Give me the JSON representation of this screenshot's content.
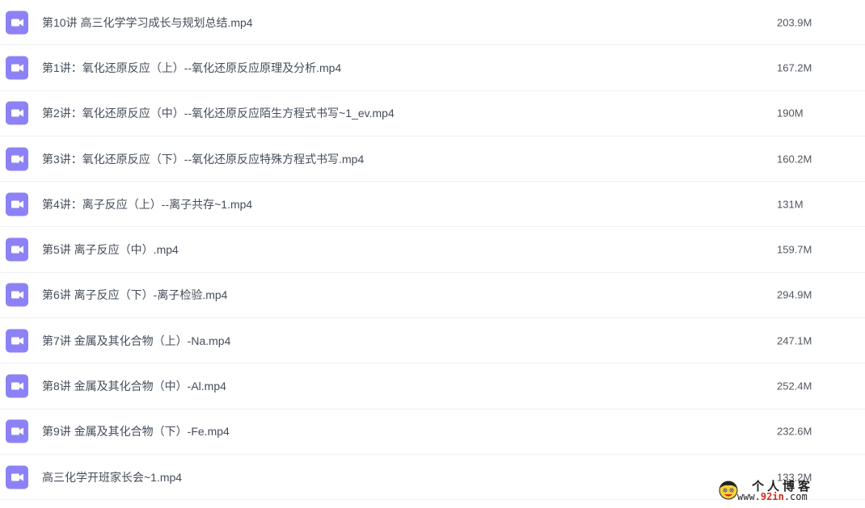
{
  "files": [
    {
      "name": "第10讲 高三化学学习成长与规划总结.mp4",
      "size": "203.9M",
      "icon": "video-icon"
    },
    {
      "name": "第1讲：氧化还原反应（上）--氧化还原反应原理及分析.mp4",
      "size": "167.2M",
      "icon": "video-icon"
    },
    {
      "name": "第2讲：氧化还原反应（中）--氧化还原反应陌生方程式书写~1_ev.mp4",
      "size": "190M",
      "icon": "video-icon"
    },
    {
      "name": "第3讲：氧化还原反应（下）--氧化还原反应特殊方程式书写.mp4",
      "size": "160.2M",
      "icon": "video-icon"
    },
    {
      "name": "第4讲：离子反应（上）--离子共存~1.mp4",
      "size": "131M",
      "icon": "video-icon"
    },
    {
      "name": "第5讲 离子反应（中）.mp4",
      "size": "159.7M",
      "icon": "video-icon"
    },
    {
      "name": "第6讲 离子反应（下）-离子检验.mp4",
      "size": "294.9M",
      "icon": "video-icon"
    },
    {
      "name": "第7讲 金属及其化合物（上）-Na.mp4",
      "size": "247.1M",
      "icon": "video-icon"
    },
    {
      "name": "第8讲 金属及其化合物（中）-Al.mp4",
      "size": "252.4M",
      "icon": "video-icon"
    },
    {
      "name": "第9讲 金属及其化合物（下）-Fe.mp4",
      "size": "232.6M",
      "icon": "video-icon"
    },
    {
      "name": "高三化学开班家长会~1.mp4",
      "size": "133.2M",
      "icon": "video-icon"
    }
  ],
  "watermark": {
    "title": "个人博客",
    "url_prefix": "www.",
    "url_accent": "92in",
    "url_suffix": ".com"
  },
  "colors": {
    "icon_bg": "#8d82f5",
    "text": "#454d5a",
    "divider": "#eef0f4"
  }
}
